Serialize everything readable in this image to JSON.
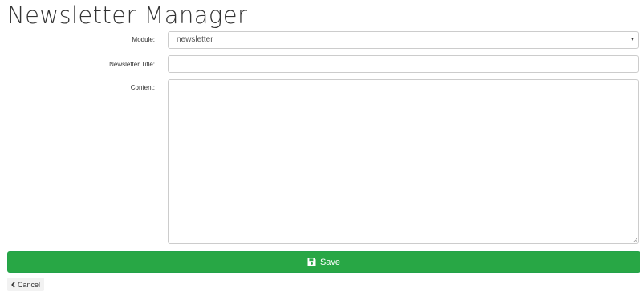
{
  "page": {
    "title": "Newsletter Manager"
  },
  "form": {
    "module": {
      "label": "Module:",
      "selected": "newsletter",
      "caret_icon": "caret-down-icon"
    },
    "newsletter_title": {
      "label": "Newsletter Title:",
      "value": "",
      "placeholder": ""
    },
    "content": {
      "label": "Content:",
      "value": "",
      "placeholder": ""
    }
  },
  "actions": {
    "save": {
      "label": "Save",
      "icon": "floppy-disk-icon",
      "color": "#28a745"
    },
    "cancel": {
      "label": "Cancel",
      "icon": "chevron-left-icon"
    }
  }
}
